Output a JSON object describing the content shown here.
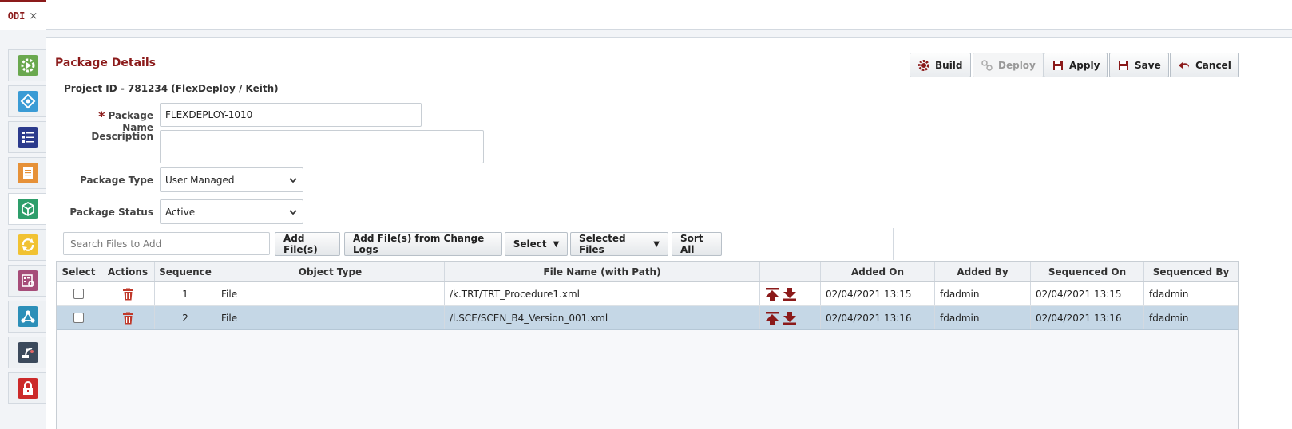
{
  "tab": {
    "label": "ODI",
    "close": "×"
  },
  "rail": [
    "build-icon",
    "workflow-icon",
    "list-icon",
    "document-icon",
    "package-icon",
    "sync-icon",
    "report-icon",
    "topology-icon",
    "robot-icon",
    "lock-icon"
  ],
  "colors": {
    "brand": "#8b1a1a",
    "selected_row": "#c5d7e6"
  },
  "page": {
    "title": "Package Details",
    "project": "Project ID - 781234 (FlexDeploy / Keith)"
  },
  "toolbar": {
    "build": "Build",
    "deploy": "Deploy",
    "apply": "Apply",
    "save": "Save",
    "cancel": "Cancel"
  },
  "form": {
    "required_mark": "*",
    "package_name_label": "Package Name",
    "package_name_value": "FLEXDEPLOY-1010",
    "description_label": "Description",
    "description_value": "",
    "package_type_label": "Package Type",
    "package_type_value": "User Managed",
    "package_status_label": "Package Status",
    "package_status_value": "Active"
  },
  "files": {
    "search_placeholder": "Search Files to Add",
    "add_files": "Add File(s)",
    "add_from_logs": "Add File(s) from Change Logs",
    "select": "Select",
    "selected_files": "Selected Files",
    "sort_all": "Sort All",
    "caret": "▼"
  },
  "grid": {
    "columns": [
      "Select",
      "Actions",
      "Sequence",
      "Object Type",
      "File Name (with Path)",
      "",
      "Added On",
      "Added By",
      "Sequenced On",
      "Sequenced By"
    ],
    "rows": [
      {
        "sequence": "1",
        "object_type": "File",
        "file_name": "/k.TRT/TRT_Procedure1.xml",
        "added_on": "02/04/2021 13:15",
        "added_by": "fdadmin",
        "sequenced_on": "02/04/2021 13:15",
        "sequenced_by": "fdadmin"
      },
      {
        "sequence": "2",
        "object_type": "File",
        "file_name": "/l.SCE/SCEN_B4_Version_001.xml",
        "added_on": "02/04/2021 13:16",
        "added_by": "fdadmin",
        "sequenced_on": "02/04/2021 13:16",
        "sequenced_by": "fdadmin"
      }
    ]
  }
}
